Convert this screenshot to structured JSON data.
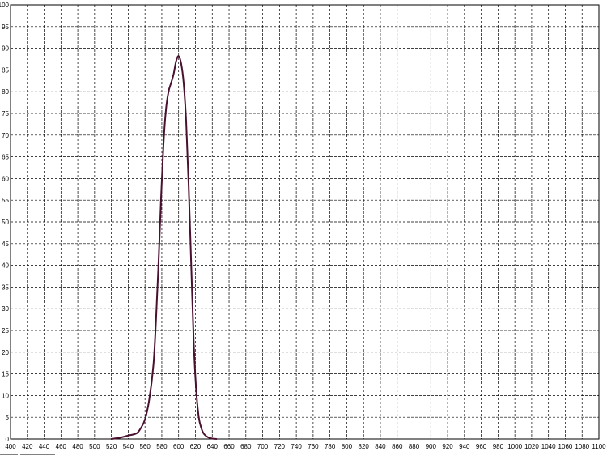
{
  "chart_data": {
    "type": "line",
    "title": "",
    "xlabel": "",
    "ylabel": "",
    "xlim": [
      400,
      1100
    ],
    "ylim": [
      0,
      100
    ],
    "grid": true,
    "legend": "none",
    "x_ticks": [
      "400",
      "420",
      "440",
      "460",
      "480",
      "500",
      "520",
      "540",
      "560",
      "580",
      "600",
      "620",
      "640",
      "660",
      "680",
      "700",
      "720",
      "740",
      "760",
      "780",
      "800",
      "820",
      "840",
      "860",
      "880",
      "900",
      "920",
      "940",
      "960",
      "980",
      "1000",
      "1020",
      "1040",
      "1060",
      "1080",
      "1100"
    ],
    "y_ticks": [
      "0",
      "5",
      "10",
      "15",
      "20",
      "25",
      "30",
      "35",
      "40",
      "45",
      "50",
      "55",
      "60",
      "65",
      "70",
      "75",
      "80",
      "85",
      "90",
      "95",
      "100"
    ],
    "series": [
      {
        "color": "#4a1030",
        "x": [
          520,
          530,
          540,
          550,
          555,
          560,
          565,
          570,
          573,
          576,
          579,
          582,
          585,
          588,
          591,
          594,
          597,
          600,
          603,
          606,
          609,
          612,
          615,
          618,
          621,
          624,
          627,
          630,
          635,
          640,
          645
        ],
        "y": [
          0,
          0.3,
          0.8,
          1.3,
          2.5,
          4.5,
          9,
          17,
          27,
          40,
          55,
          68,
          76,
          80,
          82,
          84,
          87,
          88.2,
          86.5,
          82,
          73,
          58,
          40,
          22,
          11,
          5,
          2.5,
          1.2,
          0.4,
          0.1,
          0
        ]
      }
    ]
  }
}
